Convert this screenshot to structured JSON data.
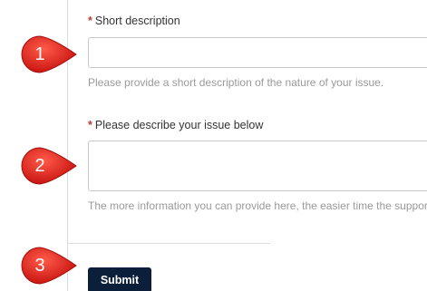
{
  "form": {
    "short_description": {
      "required_mark": "*",
      "label": "Short description",
      "value": "",
      "help": "Please provide a short description of the nature of your issue."
    },
    "issue_description": {
      "required_mark": "*",
      "label": "Please describe your issue below",
      "value": "",
      "help": "The more information you can provide here, the easier time the support team will have"
    },
    "submit_label": "Submit"
  },
  "callouts": [
    "1",
    "2",
    "3"
  ],
  "colors": {
    "marker_red": "#e02020",
    "submit_bg": "#0b1f3a",
    "required_red": "#c0392b",
    "help_gray": "#9a9a9a"
  }
}
